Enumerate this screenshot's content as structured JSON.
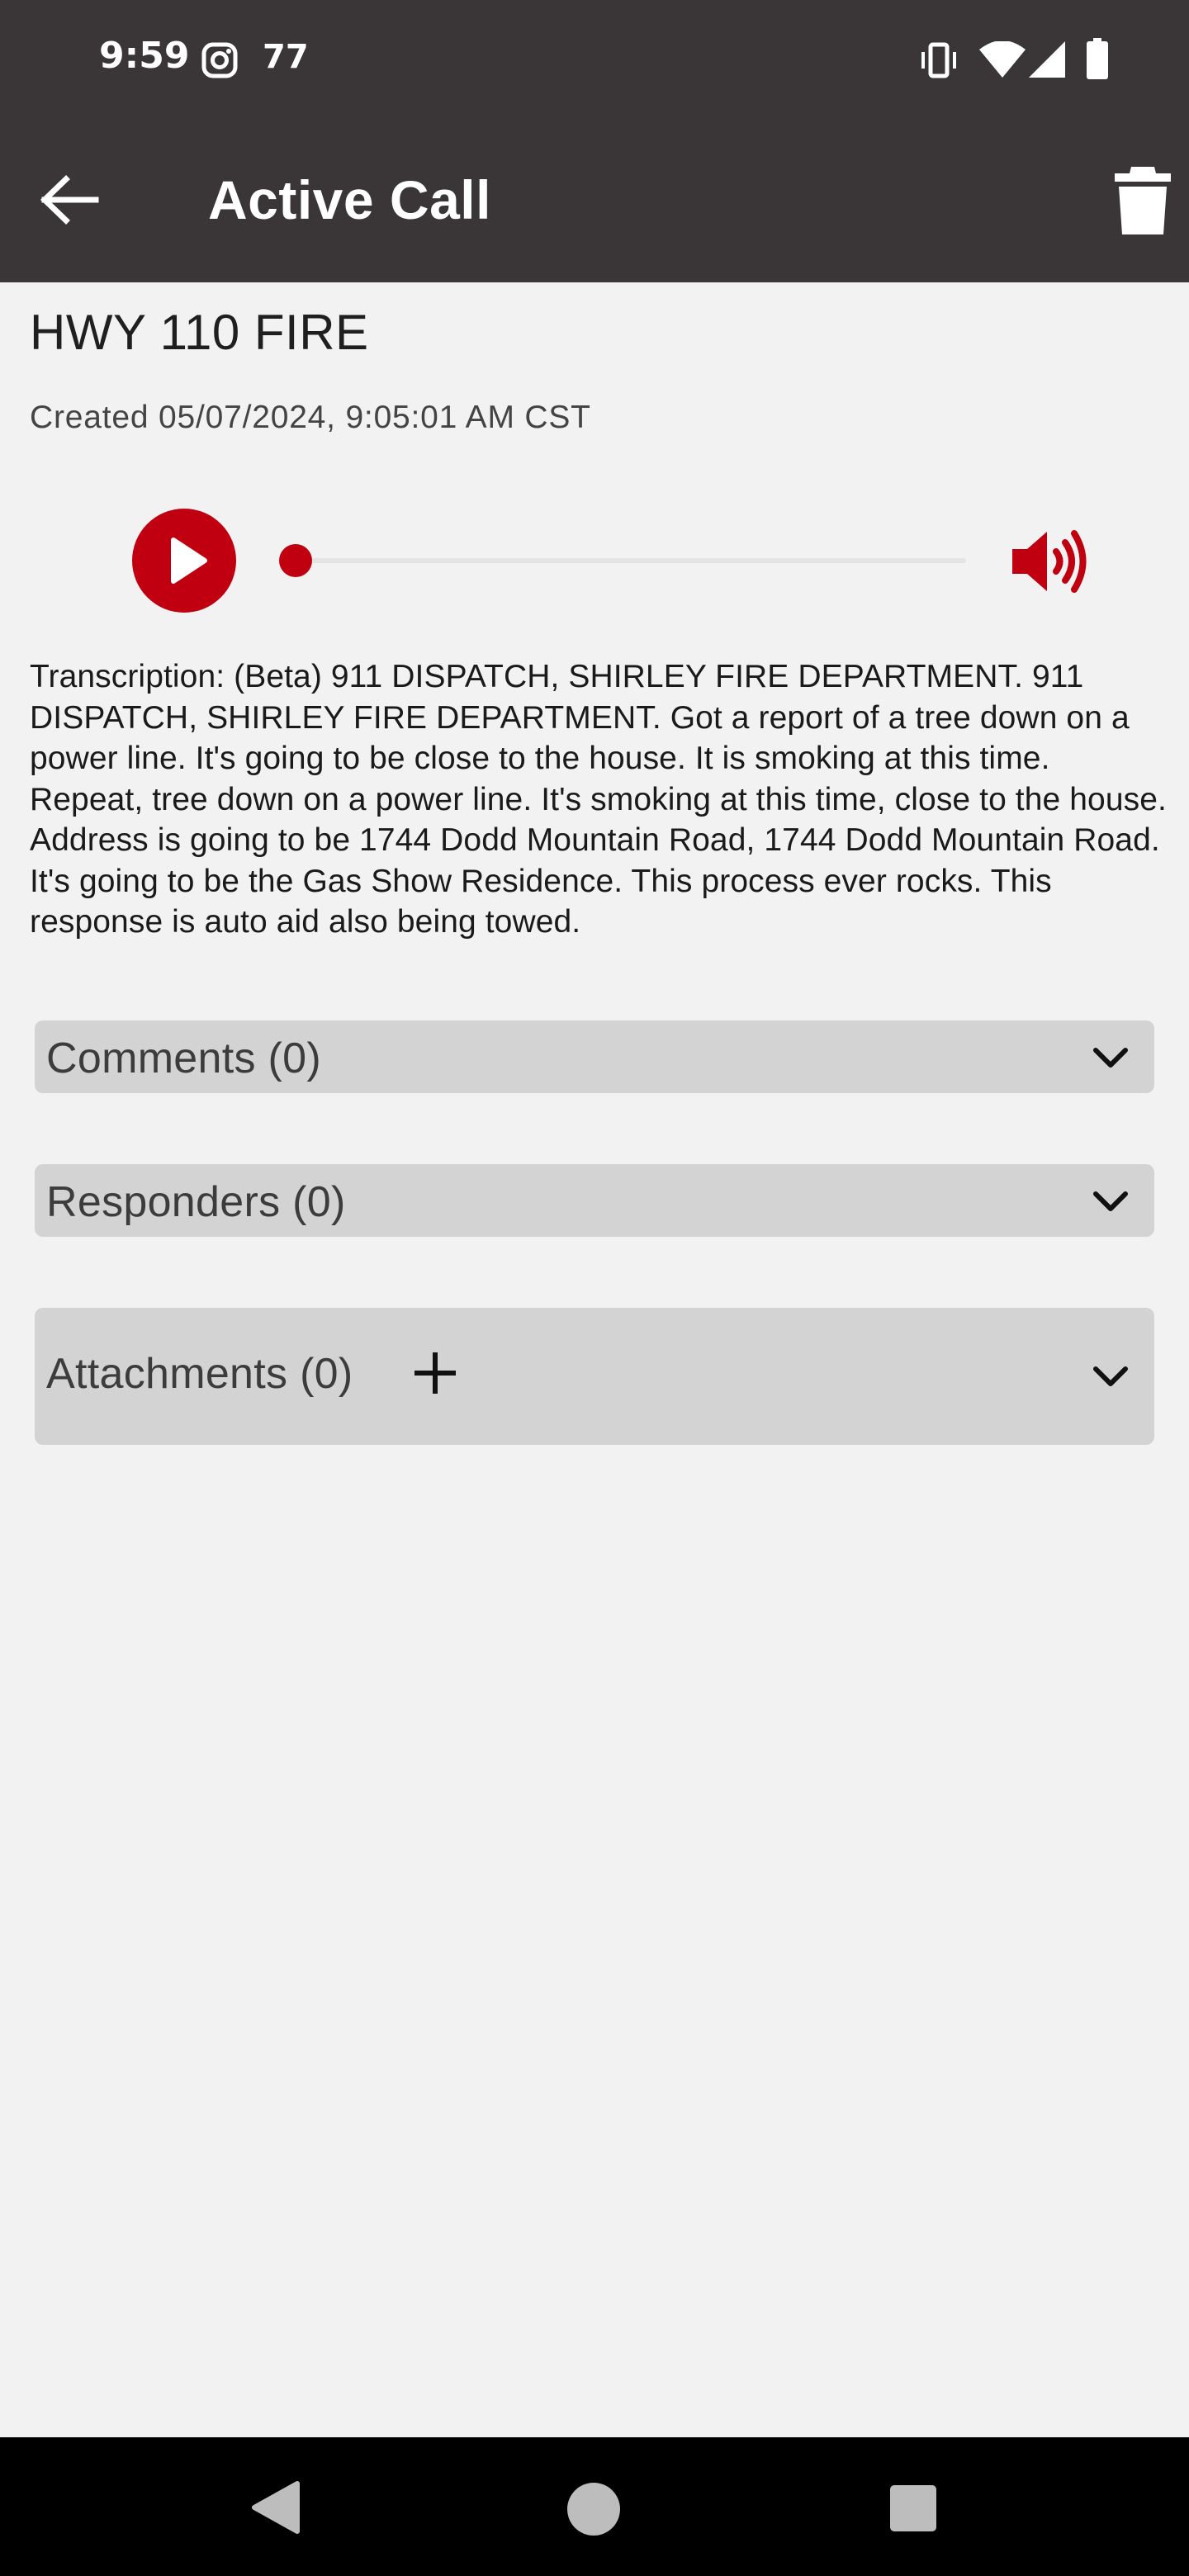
{
  "status_bar": {
    "time": "9:59",
    "notification_icon": "instagram-icon",
    "notification_count": "77",
    "icons": [
      "vibrate-icon",
      "wifi-icon",
      "signal-icon",
      "battery-icon"
    ]
  },
  "app_bar": {
    "title": "Active Call",
    "back_icon": "arrow-left-icon",
    "delete_icon": "trash-icon"
  },
  "call": {
    "title": "HWY 110 FIRE",
    "created": "Created 05/07/2024, 9:05:01 AM CST"
  },
  "player": {
    "progress": 0,
    "play_icon": "play-icon",
    "volume_icon": "volume-icon"
  },
  "transcription": "Transcription: (Beta) 911 DISPATCH, SHIRLEY FIRE DEPARTMENT. 911 DISPATCH, SHIRLEY FIRE DEPARTMENT. Got a report of a tree down on a power line. It's going to be close to the house. It is smoking at this time. Repeat, tree down on a power line. It's smoking at this time, close to the house. Address is going to be 1744 Dodd Mountain Road, 1744 Dodd Mountain Road. It's going to be the Gas Show Residence. This process ever rocks. This response is auto aid also being towed.",
  "sections": {
    "comments": "Comments (0)",
    "responders": "Responders (0)",
    "attachments": "Attachments (0)"
  },
  "colors": {
    "accent": "#c00010",
    "app_bar": "#3a3536",
    "background": "#f2f2f2",
    "section": "#d3d3d3"
  },
  "nav_bar": {
    "icons": [
      "nav-back-icon",
      "nav-home-icon",
      "nav-recents-icon"
    ]
  }
}
